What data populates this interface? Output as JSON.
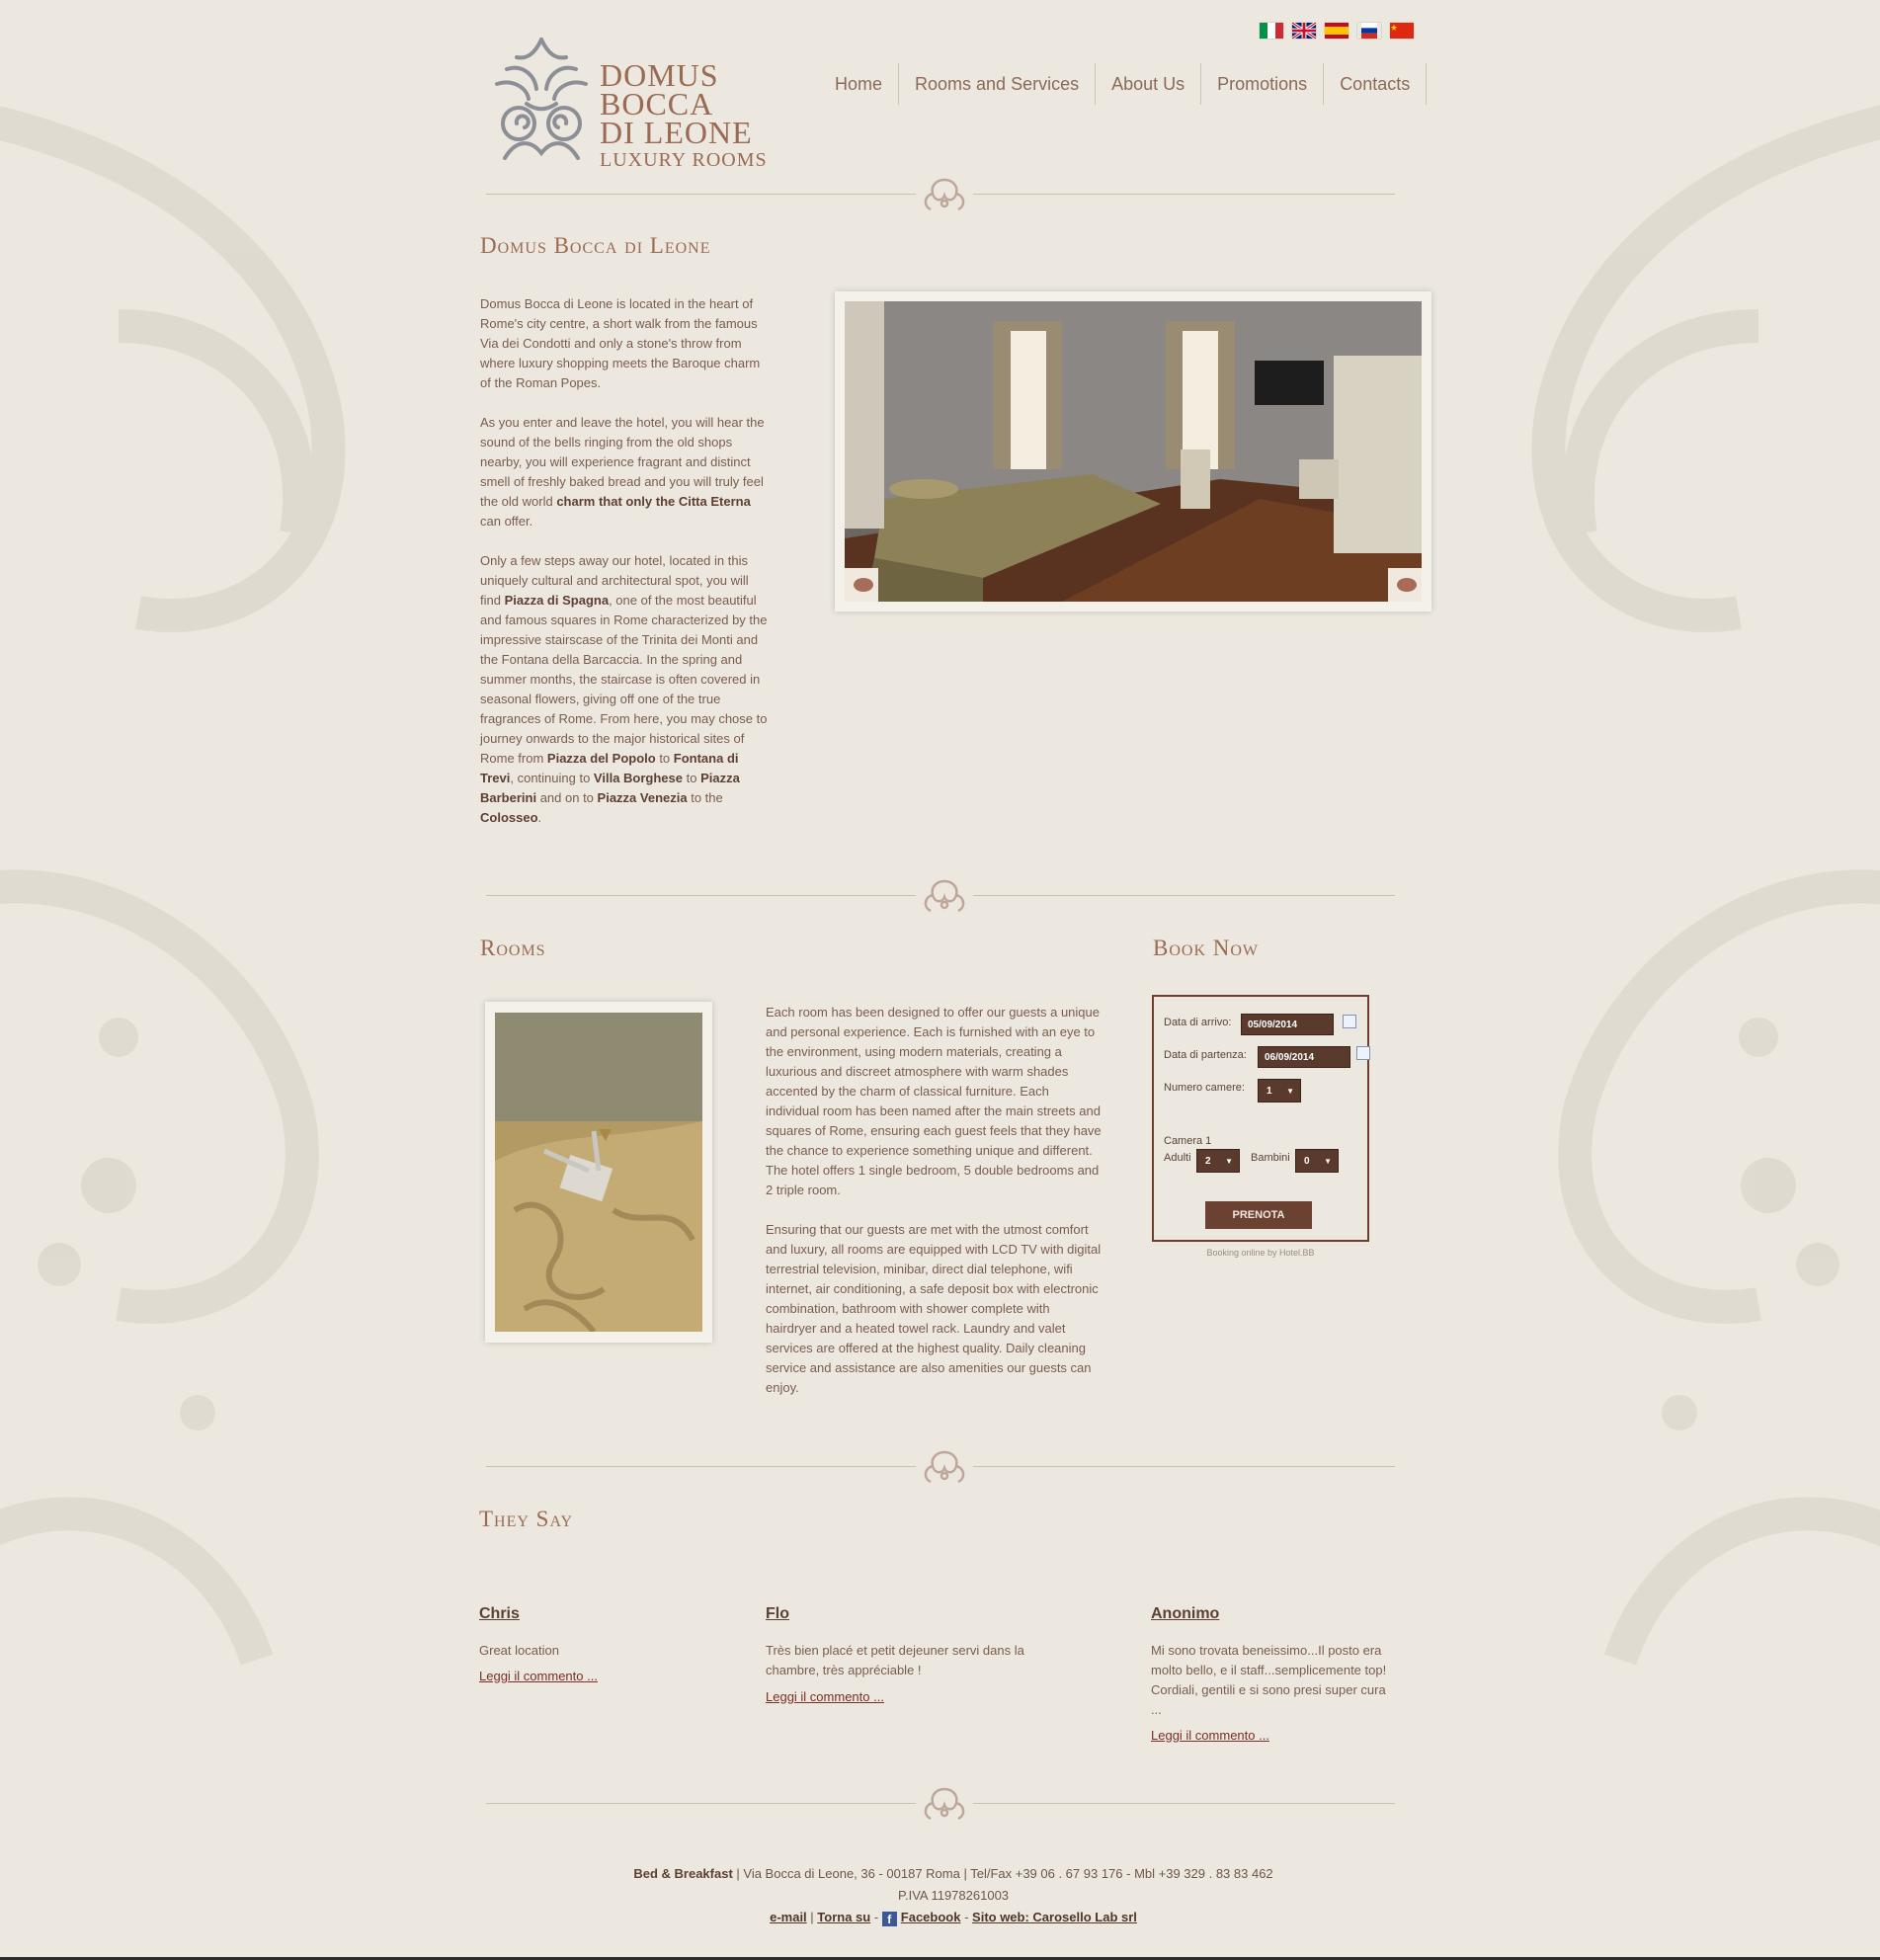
{
  "header": {
    "logo": {
      "line1": "DOMUS",
      "line2": "BOCCA",
      "line3": "DI LEONE",
      "sub": "LUXURY ROOMS"
    },
    "flags": [
      {
        "icon": "italy-flag-icon"
      },
      {
        "icon": "uk-flag-icon"
      },
      {
        "icon": "spain-flag-icon"
      },
      {
        "icon": "russia-flag-icon"
      },
      {
        "icon": "china-flag-icon"
      }
    ],
    "nav": [
      "Home",
      "Rooms and Services",
      "About Us",
      "Promotions",
      "Contacts"
    ]
  },
  "intro": {
    "title": "Domus Bocca di Leone",
    "p1": "Domus Bocca di Leone is located in the heart of Rome's city centre, a short walk from the famous Via dei Condotti and only a stone's throw from where luxury shopping meets the Baroque charm of the Roman Popes.",
    "p2_a": "As you enter and leave the hotel, you will hear the sound of the bells ringing from the old shops nearby, you will experience fragrant and distinct smell of freshly baked bread and you will truly feel the old world ",
    "p2_b": "charm that only the Citta Eterna",
    "p2_c": " can offer.",
    "p3": [
      {
        "t": "Only a few steps away our hotel, located in this uniquely cultural and architectural spot, you will find ",
        "b": false
      },
      {
        "t": "Piazza di Spagna",
        "b": true
      },
      {
        "t": ", one of the most beautiful and famous squares in Rome characterized by the impressive stairscase of the Trinita dei Monti and the Fontana della Barcaccia. In the spring and summer months, the staircase is often covered in seasonal flowers, giving off one of the true fragrances of Rome. From here, you may chose to journey onwards to the major historical sites of Rome from ",
        "b": false
      },
      {
        "t": "Piazza del Popolo",
        "b": true
      },
      {
        "t": " to ",
        "b": false
      },
      {
        "t": "Fontana di Trevi",
        "b": true
      },
      {
        "t": ", continuing to ",
        "b": false
      },
      {
        "t": "Villa Borghese",
        "b": true
      },
      {
        "t": " to ",
        "b": false
      },
      {
        "t": "Piazza Barberini",
        "b": true
      },
      {
        "t": " and on to ",
        "b": false
      },
      {
        "t": "Piazza Venezia",
        "b": true
      },
      {
        "t": " to the ",
        "b": false
      },
      {
        "t": "Colosseo",
        "b": true
      },
      {
        "t": ".",
        "b": false
      }
    ]
  },
  "rooms": {
    "title": "Rooms",
    "p1": "Each room has been designed to offer our guests a unique and personal experience. Each is furnished with an eye to the environment, using modern materials, creating a luxurious and discreet atmosphere with warm shades accented by the charm of classical furniture. Each individual room has been named after the main streets and squares of Rome, ensuring each guest feels that they have the chance to experience something unique and different. The hotel offers 1 single bedroom, 5 double bedrooms and 2 triple room.",
    "p2": "Ensuring that our guests are met with the utmost comfort and luxury, all rooms are equipped with LCD TV with digital terrestrial television, minibar, direct dial telephone, wifi internet, air conditioning, a safe deposit box with electronic combination, bathroom with shower complete with hairdryer and a heated towel rack. Laundry and valet services are offered at the highest quality. Daily cleaning service and assistance are also amenities our guests can enjoy."
  },
  "booking": {
    "title": "Book Now",
    "arrival_label": "Data di arrivo:",
    "arrival_value": "05/09/2014",
    "departure_label": "Data di partenza:",
    "departure_value": "06/09/2014",
    "rooms_label": "Numero camere:",
    "rooms_value": "1",
    "camera_label": "Camera 1",
    "adults_label": "Adulti",
    "adults_value": "2",
    "children_label": "Bambini",
    "children_value": "0",
    "button": "PRENOTA",
    "credit": "Booking online by Hotel.BB"
  },
  "reviews": {
    "title": "They Say",
    "items": [
      {
        "name": "Chris",
        "text": "Great location",
        "link": "Leggi il commento ..."
      },
      {
        "name": "Flo",
        "text": "Très bien placé et petit dejeuner servi dans la chambre, très appréciable !",
        "link": "Leggi il commento ..."
      },
      {
        "name": "Anonimo",
        "text": "Mi sono trovata beneissimo...Il posto era molto bello, e il staff...semplicemente top! Cordiali, gentili e si sono presi super cura ...",
        "link": "Leggi il commento ..."
      }
    ]
  },
  "footer": {
    "brand": "Bed & Breakfast",
    "address": " | Via Bocca di Leone, 36 - 00187 Roma | Tel/Fax +39 06 . 67 93 176 - Mbl +39 329 . 83 83 462",
    "piva": "P.IVA 11978261003",
    "email": "e-mail",
    "sep1": " | ",
    "top": "Torna su",
    "sep2": " - ",
    "facebook": "Facebook",
    "sep3": " - ",
    "site": "Sito web: Carosello Lab srl"
  },
  "colors": {
    "background": "#ece8df",
    "accent": "#9a6a53",
    "button": "#6b4132"
  }
}
